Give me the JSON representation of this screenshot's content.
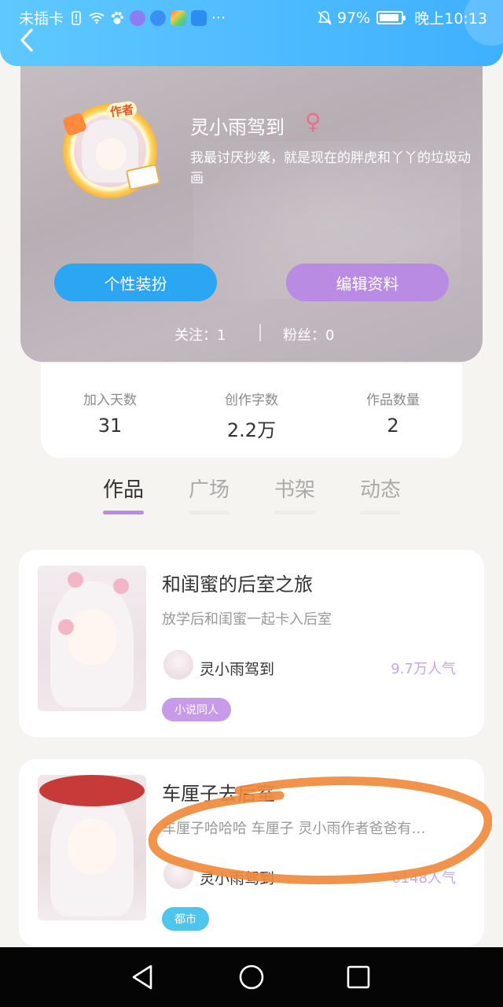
{
  "status_bar": {
    "carrier": "未插卡",
    "dots": "···",
    "battery_pct": "97%",
    "time": "晚上10:13",
    "icons": [
      "sim-alert-icon",
      "wifi-icon",
      "paw-icon",
      "music-app-icon",
      "browser-app-icon",
      "gallery-app-icon",
      "weather-app-icon",
      "mute-icon",
      "battery-icon"
    ]
  },
  "header": {
    "back_icon": "back-arrow-icon"
  },
  "profile": {
    "username": "灵小雨驾到",
    "gender_symbol": "♀",
    "signature": "我最讨厌抄袭，就是现在的胖虎和丫丫的垃圾动画",
    "author_badge": "作者",
    "buttons": {
      "dress_up": "个性装扮",
      "edit_profile": "编辑资料"
    },
    "follow": {
      "following": "关注：1",
      "followers": "粉丝：0"
    }
  },
  "stats": [
    {
      "label": "加入天数",
      "value": "31"
    },
    {
      "label": "创作字数",
      "value": "2.2万"
    },
    {
      "label": "作品数量",
      "value": "2"
    }
  ],
  "tabs": [
    {
      "label": "作品",
      "active": true
    },
    {
      "label": "广场",
      "active": false
    },
    {
      "label": "书架",
      "active": false
    },
    {
      "label": "动态",
      "active": false
    }
  ],
  "works": [
    {
      "title": "和闺蜜的后室之旅",
      "desc": "放学后和闺蜜一起卡入后室",
      "author": "灵小雨驾到",
      "popularity": "9.7万人气",
      "tag": "小说同人"
    },
    {
      "title": "车厘子去后室",
      "desc": "车厘子哈哈哈 车厘子 灵小雨作者爸爸有…",
      "author": "灵小雨驾到",
      "popularity": "6148人气",
      "tag": "都市"
    }
  ],
  "colors": {
    "header": "#3fb0ff",
    "dress_button": "#2aa6f2",
    "edit_button": "#b98be2",
    "active_tab_underline": "#b98be2",
    "popularity": "#c9a4ea",
    "annotation": "#f08a3c"
  }
}
